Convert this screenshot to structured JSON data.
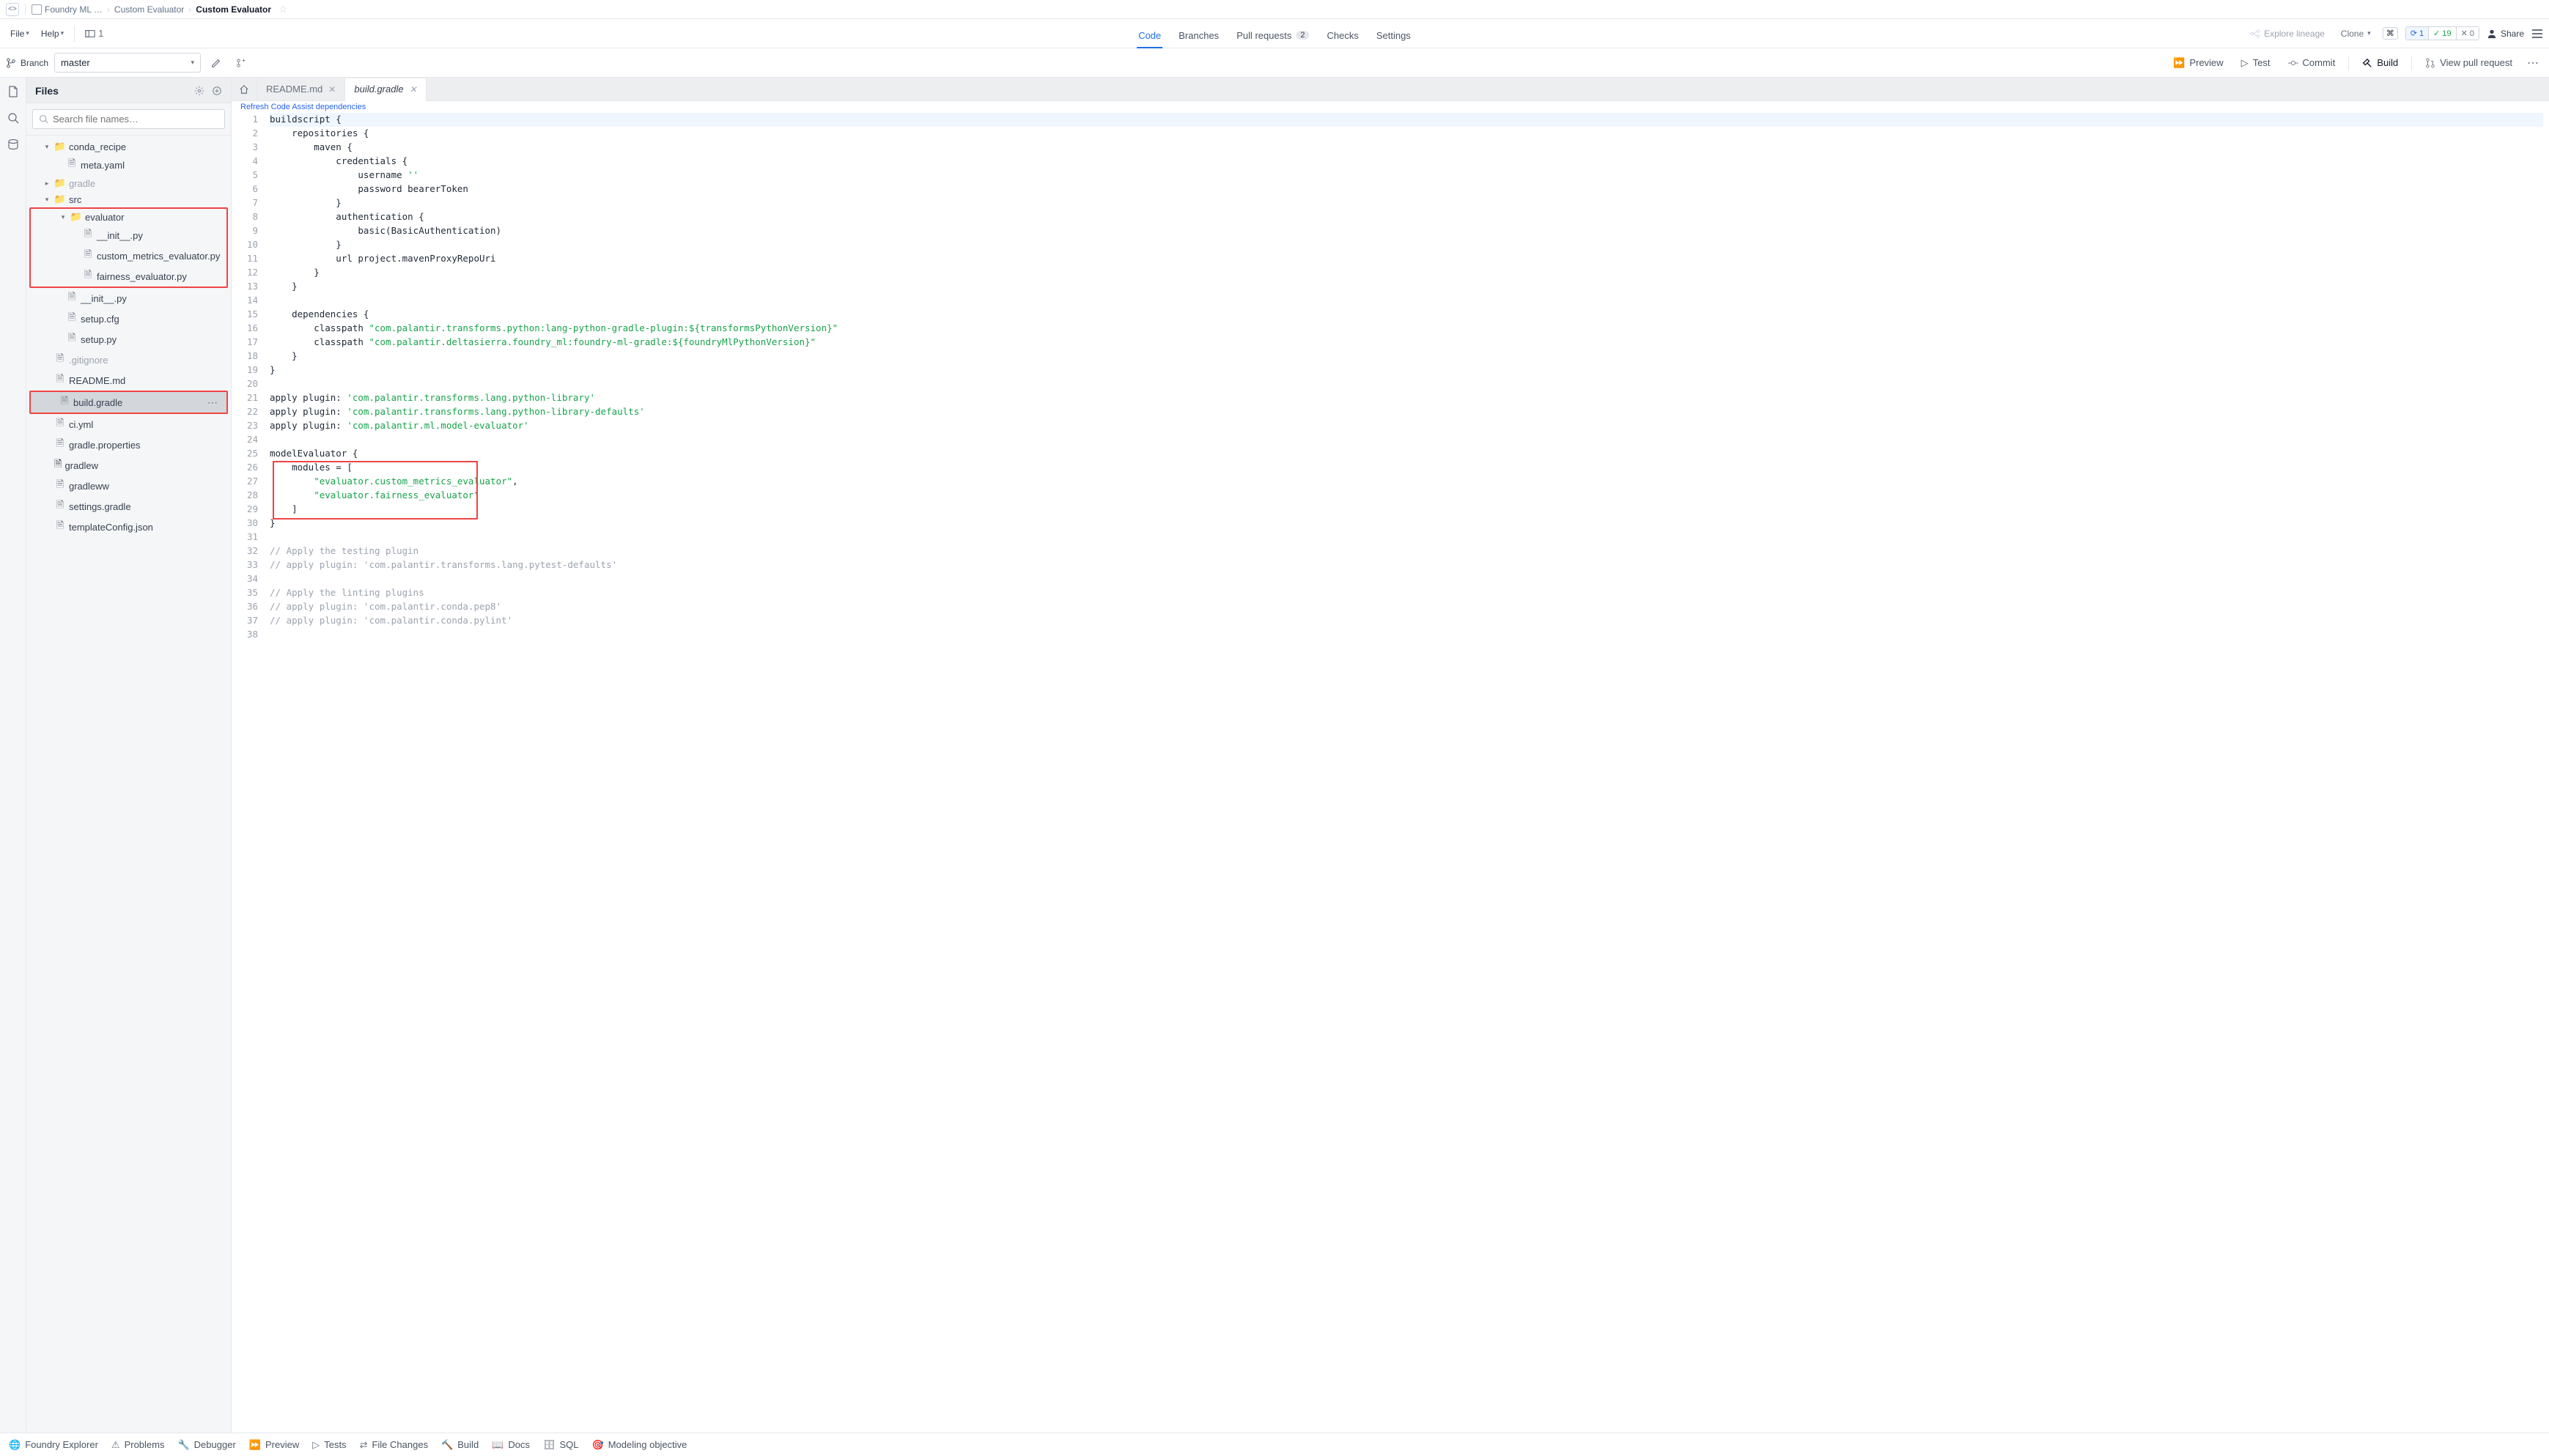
{
  "breadcrumb": {
    "items": [
      "Foundry ML …",
      "Custom Evaluator",
      "Custom Evaluator"
    ]
  },
  "menus": {
    "file": "File",
    "help": "Help",
    "workspace_count": "1"
  },
  "main_tabs": {
    "code": "Code",
    "branches": "Branches",
    "prs": "Pull requests",
    "prs_count": "2",
    "checks": "Checks",
    "settings": "Settings"
  },
  "top_right": {
    "explore": "Explore lineage",
    "clone": "Clone",
    "share": "Share",
    "sync_count": "1",
    "check_count": "19",
    "x_count": "0"
  },
  "branch": {
    "label": "Branch",
    "value": "master"
  },
  "actions": {
    "preview": "Preview",
    "test": "Test",
    "commit": "Commit",
    "build": "Build",
    "view_pr": "View pull request"
  },
  "files_panel": {
    "title": "Files",
    "search_placeholder": "Search file names…",
    "tree": {
      "conda_recipe": "conda_recipe",
      "meta_yaml": "meta.yaml",
      "gradle": "gradle",
      "src": "src",
      "evaluator": "evaluator",
      "init_py": "__init__.py",
      "custom_metrics": "custom_metrics_evaluator.py",
      "fairness": "fairness_evaluator.py",
      "init_py2": "__init__.py",
      "setup_cfg": "setup.cfg",
      "setup_py": "setup.py",
      "gitignore": ".gitignore",
      "readme": "README.md",
      "build_gradle": "build.gradle",
      "ci_yml": "ci.yml",
      "gradle_props": "gradle.properties",
      "gradlew": "gradlew",
      "gradleww": "gradleww",
      "settings_gradle": "settings.gradle",
      "template_config": "templateConfig.json"
    }
  },
  "editor": {
    "tabs": {
      "readme": "README.md",
      "build": "build.gradle"
    },
    "hint": "Refresh Code Assist dependencies"
  },
  "code_lines": [
    "buildscript {",
    "    repositories {",
    "        maven {",
    "            credentials {",
    "                username ''",
    "                password bearerToken",
    "            }",
    "            authentication {",
    "                basic(BasicAuthentication)",
    "            }",
    "            url project.mavenProxyRepoUri",
    "        }",
    "    }",
    "",
    "    dependencies {",
    "        classpath \"com.palantir.transforms.python:lang-python-gradle-plugin:${transformsPythonVersion}\"",
    "        classpath \"com.palantir.deltasierra.foundry_ml:foundry-ml-gradle:${foundryMlPythonVersion}\"",
    "    }",
    "}",
    "",
    "apply plugin: 'com.palantir.transforms.lang.python-library'",
    "apply plugin: 'com.palantir.transforms.lang.python-library-defaults'",
    "apply plugin: 'com.palantir.ml.model-evaluator'",
    "",
    "modelEvaluator {",
    "    modules = [",
    "        \"evaluator.custom_metrics_evaluator\",",
    "        \"evaluator.fairness_evaluator\"",
    "    ]",
    "}",
    "",
    "// Apply the testing plugin",
    "// apply plugin: 'com.palantir.transforms.lang.pytest-defaults'",
    "",
    "// Apply the linting plugins",
    "// apply plugin: 'com.palantir.conda.pep8'",
    "// apply plugin: 'com.palantir.conda.pylint'",
    ""
  ],
  "bottom": {
    "explorer": "Foundry Explorer",
    "problems": "Problems",
    "debugger": "Debugger",
    "preview": "Preview",
    "tests": "Tests",
    "file_changes": "File Changes",
    "build": "Build",
    "docs": "Docs",
    "sql": "SQL",
    "modeling": "Modeling objective"
  }
}
